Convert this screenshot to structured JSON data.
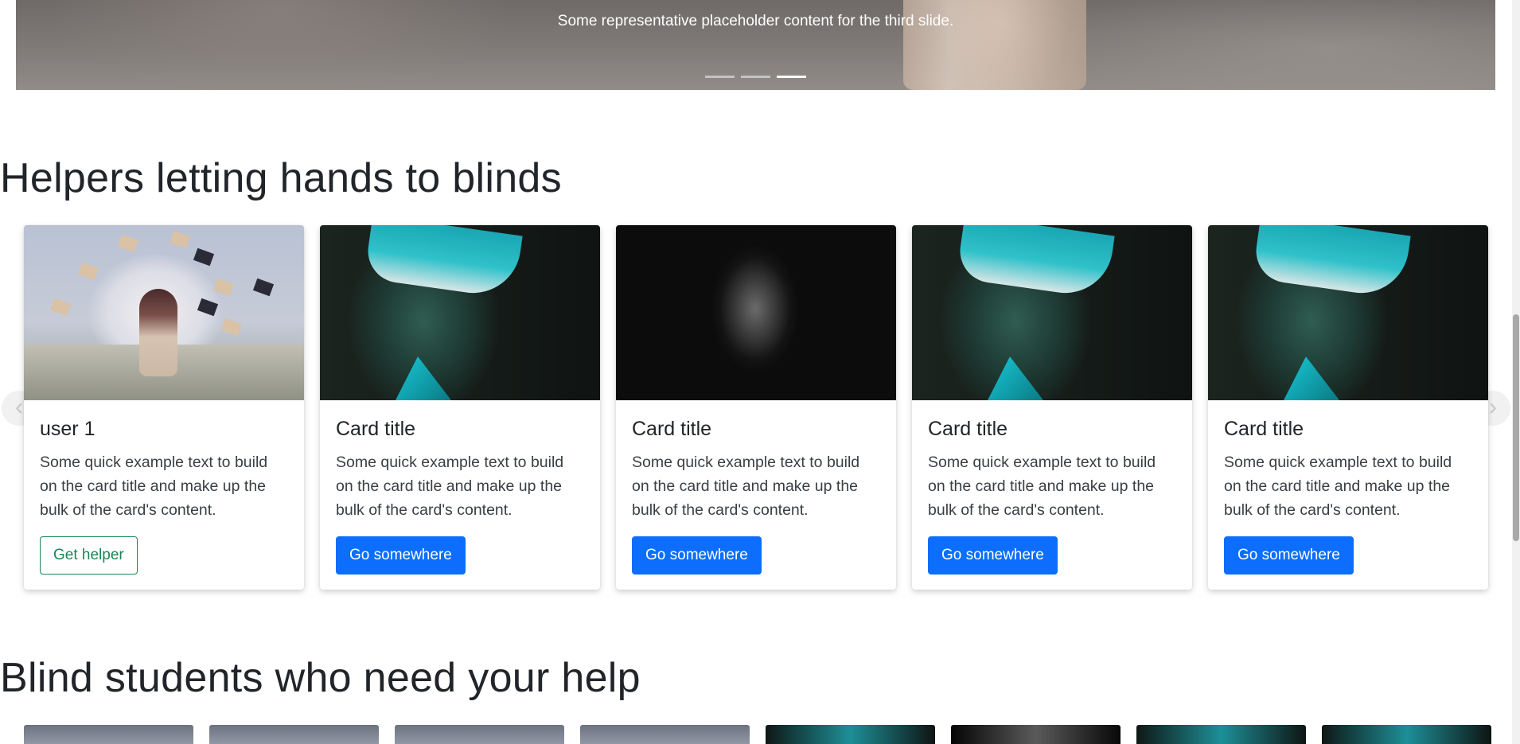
{
  "hero": {
    "caption": "Some representative placeholder content for the third slide.",
    "indicators": [
      {
        "label": "Slide 1",
        "active": false
      },
      {
        "label": "Slide 2",
        "active": false
      },
      {
        "label": "Slide 3",
        "active": true
      }
    ]
  },
  "helpers_section": {
    "title": "Helpers letting hands to blinds",
    "cards": [
      {
        "title": "user 1",
        "text": "Some quick example text to build on the card title and make up the bulk of the card's content.",
        "button": "Get helper",
        "image": "books-flying-room"
      },
      {
        "title": "Card title",
        "text": "Some quick example text to build on the card title and make up the bulk of the card's content.",
        "button": "Go somewhere",
        "image": "blindfolded-person"
      },
      {
        "title": "Card title",
        "text": "Some quick example text to build on the card title and make up the bulk of the card's content.",
        "button": "Go somewhere",
        "image": "dark-portrait"
      },
      {
        "title": "Card title",
        "text": "Some quick example text to build on the card title and make up the bulk of the card's content.",
        "button": "Go somewhere",
        "image": "blindfolded-person"
      },
      {
        "title": "Card title",
        "text": "Some quick example text to build on the card title and make up the bulk of the card's content.",
        "button": "Go somewhere",
        "image": "blindfolded-person"
      }
    ],
    "nav": {
      "prev_icon": "chevron-left-icon",
      "next_icon": "chevron-right-icon"
    }
  },
  "students_section": {
    "title": "Blind students who need your help"
  },
  "colors": {
    "primary": "#0d6efd",
    "success": "#198754",
    "text": "#212529"
  }
}
